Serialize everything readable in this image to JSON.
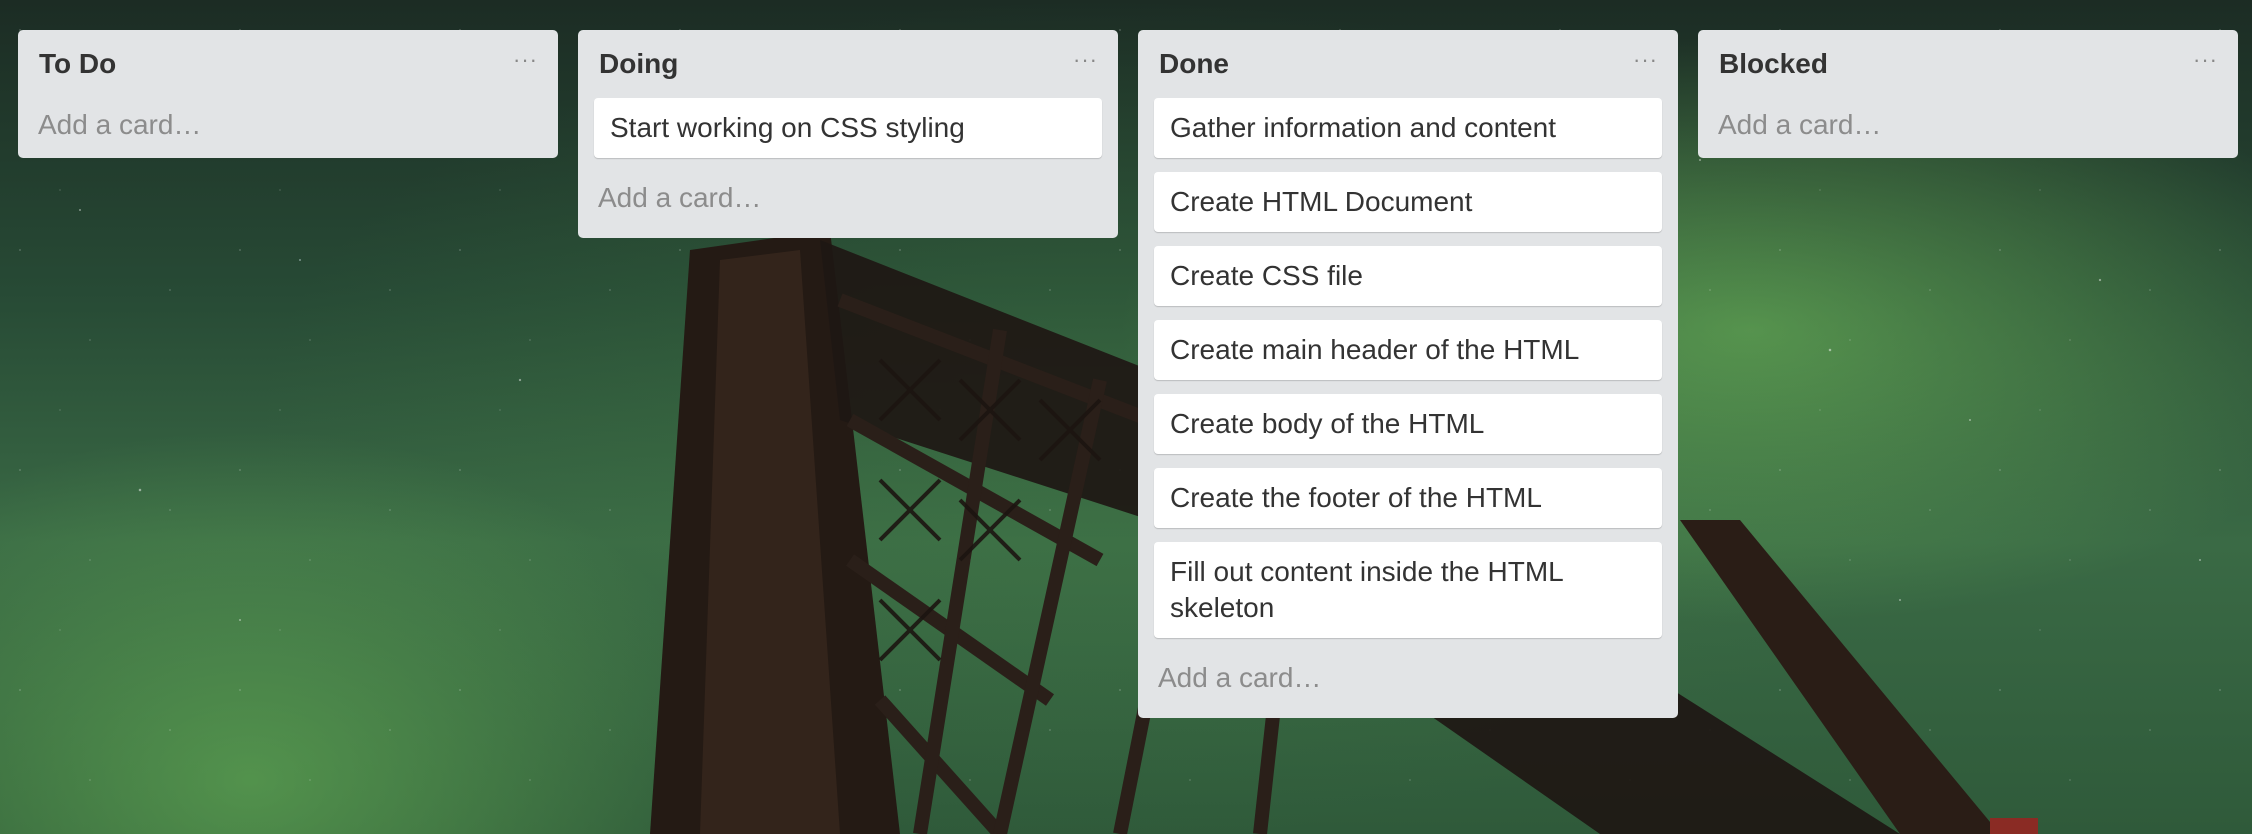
{
  "board": {
    "lists": [
      {
        "title": "To Do",
        "menu_icon": "ellipsis-icon",
        "cards": [],
        "add_card_label": "Add a card…"
      },
      {
        "title": "Doing",
        "menu_icon": "ellipsis-icon",
        "cards": [
          "Start working on CSS styling"
        ],
        "add_card_label": "Add a card…"
      },
      {
        "title": "Done",
        "menu_icon": "ellipsis-icon",
        "cards": [
          "Gather information and content",
          "Create HTML Document",
          "Create CSS file",
          "Create main header of the HTML",
          "Create body of the HTML",
          "Create the footer of the HTML",
          "Fill out content inside the HTML skeleton"
        ],
        "add_card_label": "Add a card…"
      },
      {
        "title": "Blocked",
        "menu_icon": "ellipsis-icon",
        "cards": [],
        "add_card_label": "Add a card…"
      }
    ]
  },
  "menu_glyph": "···",
  "colors": {
    "list_bg": "#e2e4e6",
    "card_bg": "#ffffff",
    "title_text": "#333333",
    "add_card_text": "#8c8c8c"
  }
}
